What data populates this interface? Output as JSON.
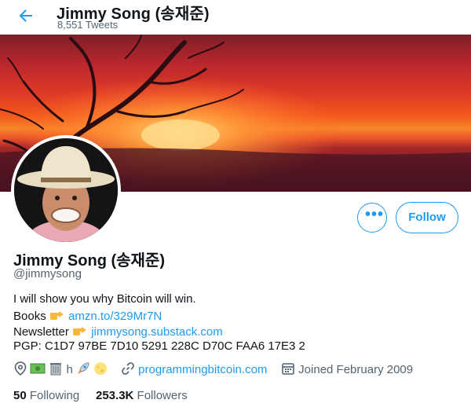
{
  "header": {
    "title": "Jimmy Song (송재준)",
    "tweets": "8,551 Tweets"
  },
  "actions": {
    "more_label": "•••",
    "follow_label": "Follow"
  },
  "profile": {
    "name": "Jimmy Song (송재준)",
    "handle": "@jimmysong",
    "bio_line1": "I will show you why Bitcoin will win.",
    "books_label": "Books",
    "books_link": "amzn.to/329Mr7N",
    "newsletter_label": "Newsletter",
    "newsletter_link": "jimmysong.substack.com",
    "pgp": "PGP: C1D7 97BE 7D10 5291 228C D70C FAA6 17E3 2"
  },
  "meta": {
    "location_text": "h",
    "website": "programmingbitcoin.com",
    "joined": "Joined February 2009"
  },
  "stats": {
    "following_count": "50",
    "following_label": "Following",
    "followers_count": "253.3K",
    "followers_label": "Followers"
  },
  "colors": {
    "accent": "#1d9bf0",
    "muted": "#536471",
    "text": "#0f1419"
  },
  "icons": [
    "back-arrow-icon",
    "more-dots-icon",
    "location-pin-icon",
    "money-emoji-icon",
    "trash-can-emoji-icon",
    "rocket-emoji-icon",
    "moon-emoji-icon",
    "link-icon",
    "calendar-icon",
    "pointing-hand-emoji-icon"
  ]
}
